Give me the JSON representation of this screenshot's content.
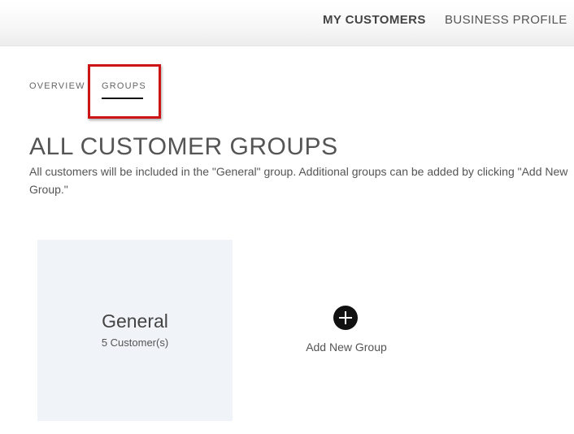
{
  "top_nav": {
    "items": [
      {
        "label": "MY CUSTOMERS",
        "active": true
      },
      {
        "label": "BUSINESS PROFILE",
        "active": false
      }
    ]
  },
  "sub_tabs": {
    "items": [
      {
        "label": "OVERVIEW",
        "active": false
      },
      {
        "label": "GROUPS",
        "active": true
      }
    ]
  },
  "page": {
    "title": "ALL CUSTOMER GROUPS",
    "description": "All customers will be included in the \"General\" group. Additional groups can be added by clicking \"Add New Group.\""
  },
  "groups": [
    {
      "name": "General",
      "count_label": "5 Customer(s)"
    }
  ],
  "add_group": {
    "label": "Add New Group",
    "icon": "plus-circle-icon"
  },
  "colors": {
    "highlight": "#cc1414",
    "card_background": "#f0f3f8",
    "text": "#555555"
  }
}
